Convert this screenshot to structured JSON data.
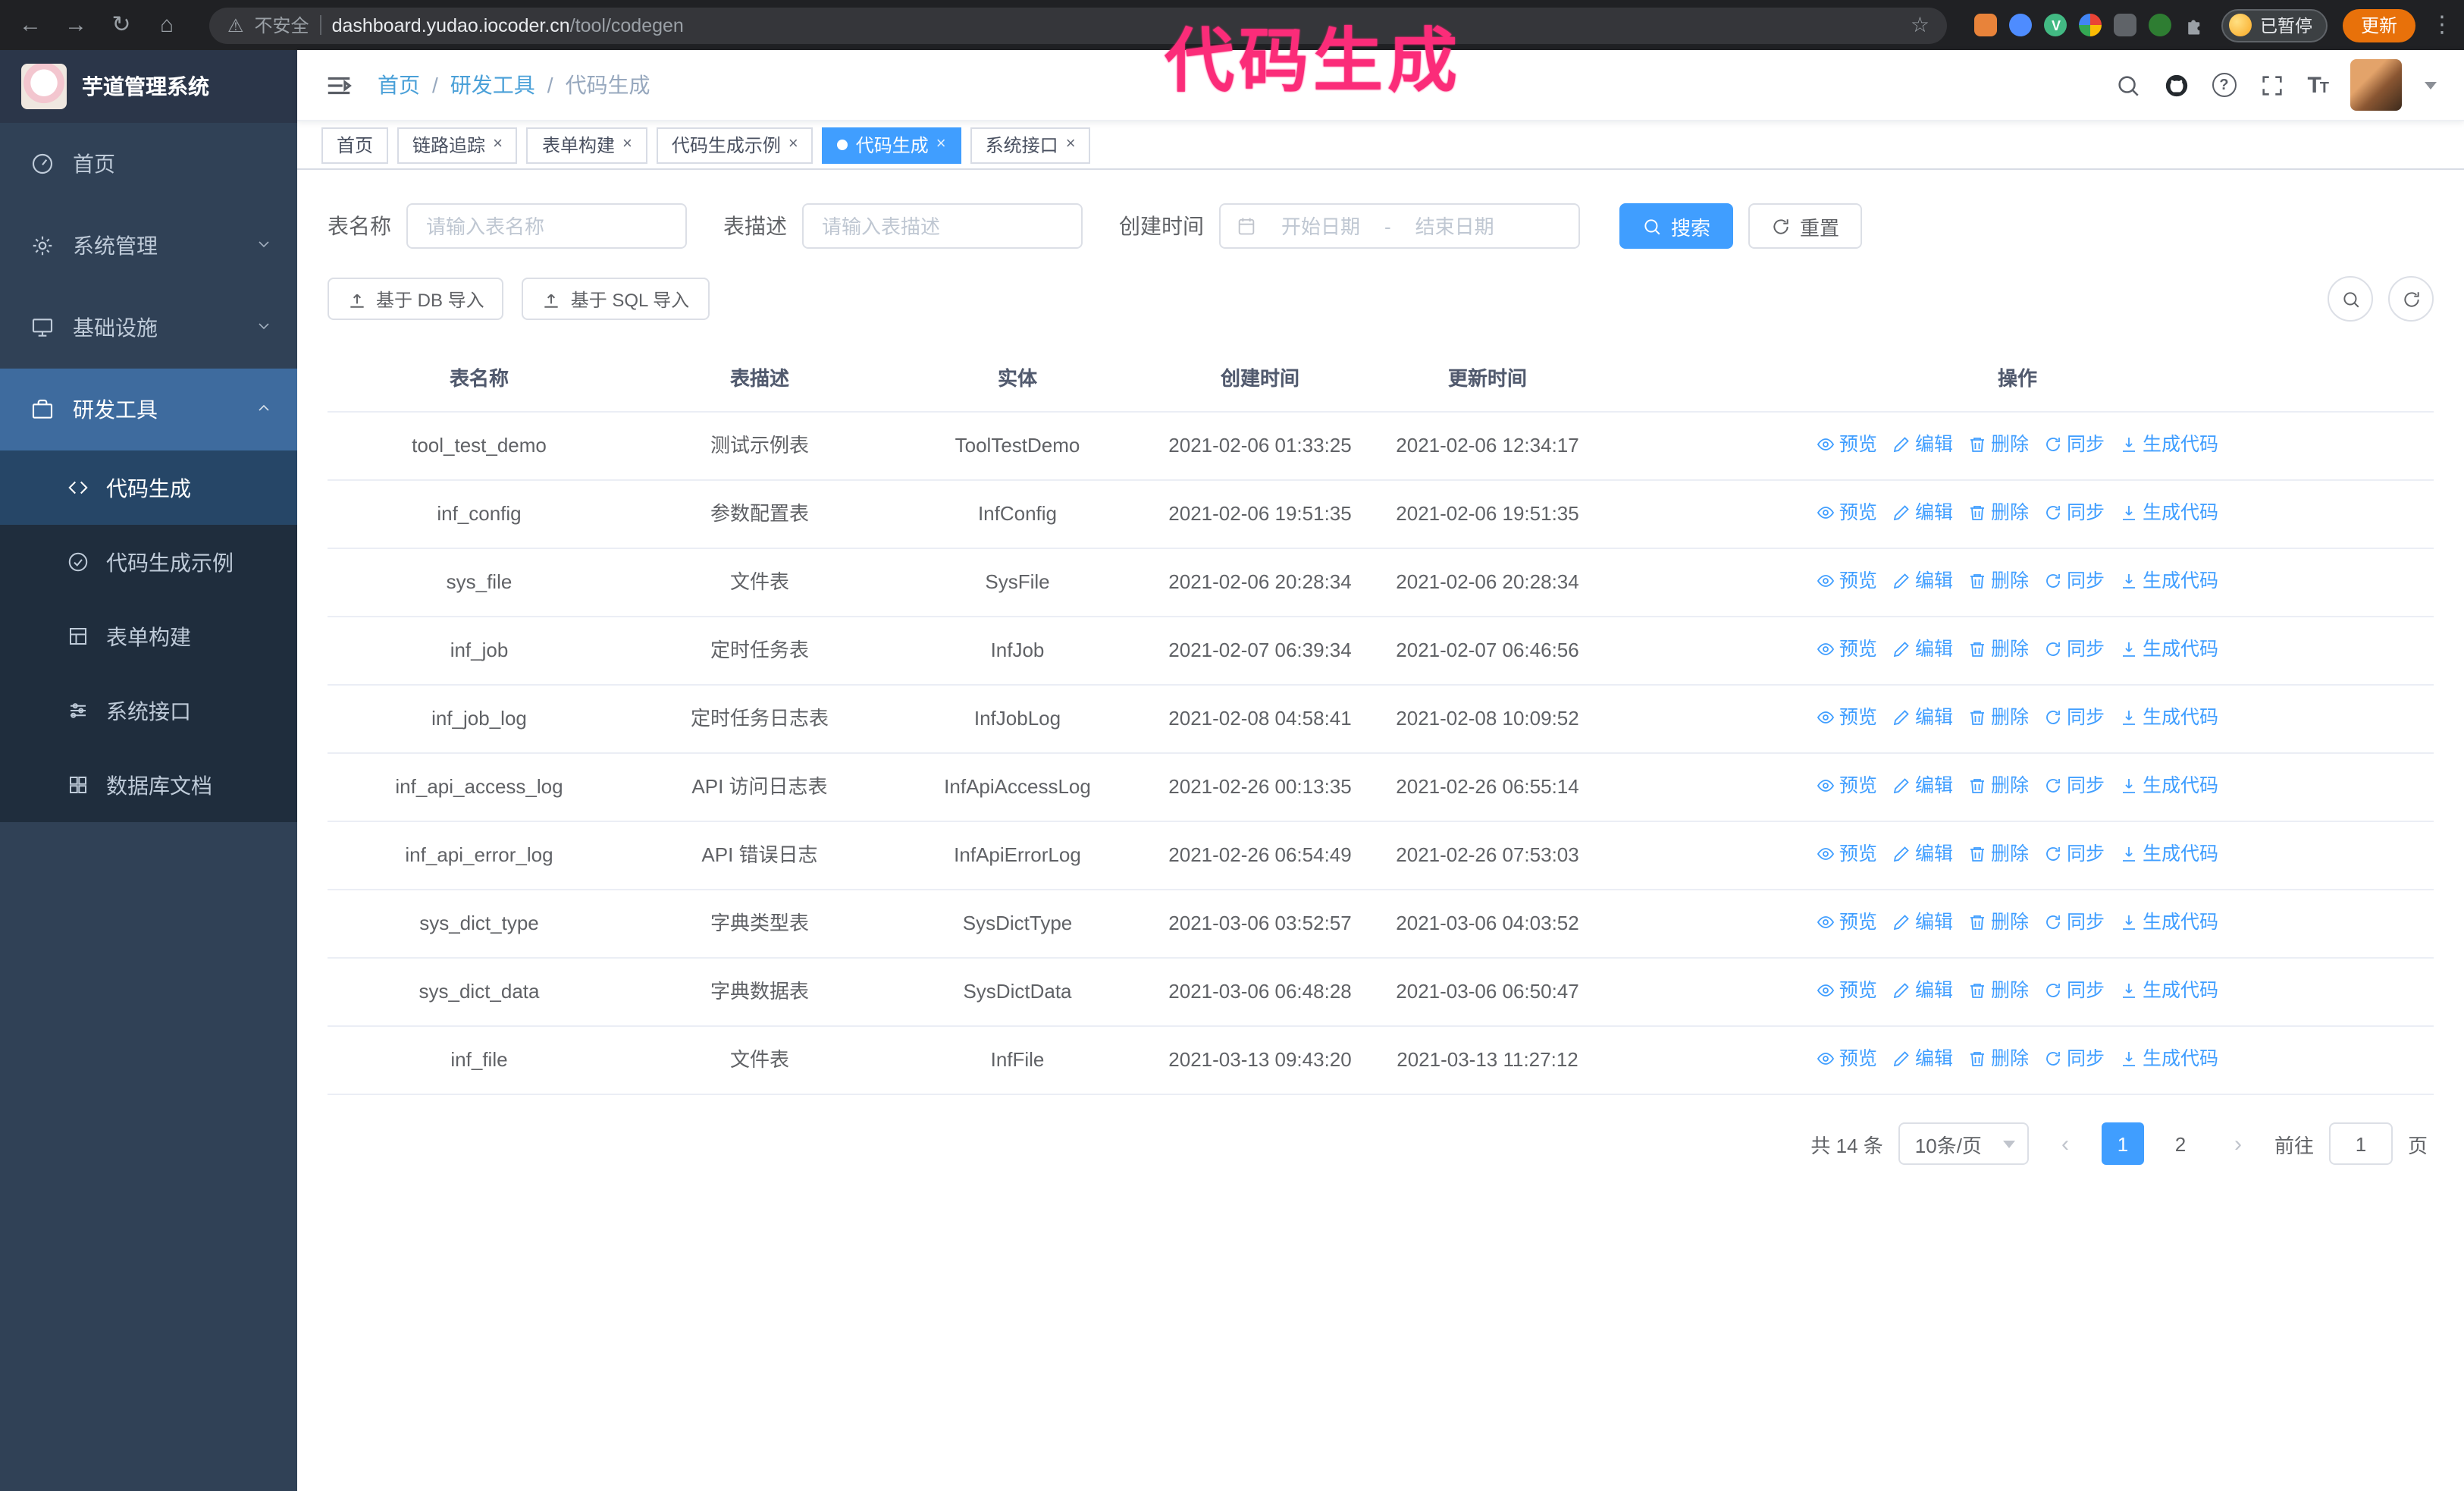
{
  "overlay": {
    "annotation": "代码生成"
  },
  "browser": {
    "security_label": "不安全",
    "url_host": "dashboard.yudao.iocoder.cn",
    "url_path": "/tool/codegen",
    "profile_badge": "已暂停",
    "update_button": "更新"
  },
  "sidebar": {
    "logo_title": "芋道管理系统",
    "items": [
      {
        "label": "首页"
      },
      {
        "label": "系统管理"
      },
      {
        "label": "基础设施"
      },
      {
        "label": "研发工具"
      }
    ],
    "submenu": [
      {
        "label": "代码生成"
      },
      {
        "label": "代码生成示例"
      },
      {
        "label": "表单构建"
      },
      {
        "label": "系统接口"
      },
      {
        "label": "数据库文档"
      }
    ]
  },
  "breadcrumb": {
    "items": [
      "首页",
      "研发工具",
      "代码生成"
    ],
    "separator": "/"
  },
  "tabs": [
    {
      "label": "首页"
    },
    {
      "label": "链路追踪"
    },
    {
      "label": "表单构建"
    },
    {
      "label": "代码生成示例"
    },
    {
      "label": "代码生成"
    },
    {
      "label": "系统接口"
    }
  ],
  "filters": {
    "name_label": "表名称",
    "name_placeholder": "请输入表名称",
    "desc_label": "表描述",
    "desc_placeholder": "请输入表描述",
    "time_label": "创建时间",
    "start_placeholder": "开始日期",
    "range_separator": "-",
    "end_placeholder": "结束日期",
    "search_button": "搜索",
    "reset_button": "重置"
  },
  "toolbar": {
    "import_db": "基于 DB 导入",
    "import_sql": "基于 SQL 导入"
  },
  "table": {
    "columns": [
      "表名称",
      "表描述",
      "实体",
      "创建时间",
      "更新时间",
      "操作"
    ],
    "actions": [
      {
        "key": "preview",
        "icon": "eye-icon",
        "label": "预览"
      },
      {
        "key": "edit",
        "icon": "edit-icon",
        "label": "编辑"
      },
      {
        "key": "delete",
        "icon": "delete-icon",
        "label": "删除"
      },
      {
        "key": "sync",
        "icon": "sync-icon",
        "label": "同步"
      },
      {
        "key": "generate",
        "icon": "download-icon",
        "label": "生成代码"
      }
    ],
    "rows": [
      {
        "name": "tool_test_demo",
        "desc": "测试示例表",
        "entity": "ToolTestDemo",
        "created": "2021-02-06 01:33:25",
        "updated": "2021-02-06 12:34:17"
      },
      {
        "name": "inf_config",
        "desc": "参数配置表",
        "entity": "InfConfig",
        "created": "2021-02-06 19:51:35",
        "updated": "2021-02-06 19:51:35"
      },
      {
        "name": "sys_file",
        "desc": "文件表",
        "entity": "SysFile",
        "created": "2021-02-06 20:28:34",
        "updated": "2021-02-06 20:28:34"
      },
      {
        "name": "inf_job",
        "desc": "定时任务表",
        "entity": "InfJob",
        "created": "2021-02-07 06:39:34",
        "updated": "2021-02-07 06:46:56"
      },
      {
        "name": "inf_job_log",
        "desc": "定时任务日志表",
        "entity": "InfJobLog",
        "created": "2021-02-08 04:58:41",
        "updated": "2021-02-08 10:09:52"
      },
      {
        "name": "inf_api_access_log",
        "desc": "API 访问日志表",
        "entity": "InfApiAccessLog",
        "created": "2021-02-26 00:13:35",
        "updated": "2021-02-26 06:55:14"
      },
      {
        "name": "inf_api_error_log",
        "desc": "API 错误日志",
        "entity": "InfApiErrorLog",
        "created": "2021-02-26 06:54:49",
        "updated": "2021-02-26 07:53:03"
      },
      {
        "name": "sys_dict_type",
        "desc": "字典类型表",
        "entity": "SysDictType",
        "created": "2021-03-06 03:52:57",
        "updated": "2021-03-06 04:03:52"
      },
      {
        "name": "sys_dict_data",
        "desc": "字典数据表",
        "entity": "SysDictData",
        "created": "2021-03-06 06:48:28",
        "updated": "2021-03-06 06:50:47"
      },
      {
        "name": "inf_file",
        "desc": "文件表",
        "entity": "InfFile",
        "created": "2021-03-13 09:43:20",
        "updated": "2021-03-13 11:27:12"
      }
    ]
  },
  "pagination": {
    "total": "共 14 条",
    "page_size": "10条/页",
    "pages": [
      "1",
      "2"
    ],
    "active_page": "1",
    "goto_label": "前往",
    "goto_value": "1",
    "goto_suffix": "页"
  },
  "colors": {
    "accent": "#409eff",
    "annotation": "#fb2c79",
    "sidebar_bg": "#304156",
    "submenu_bg": "#1f2d3d"
  }
}
